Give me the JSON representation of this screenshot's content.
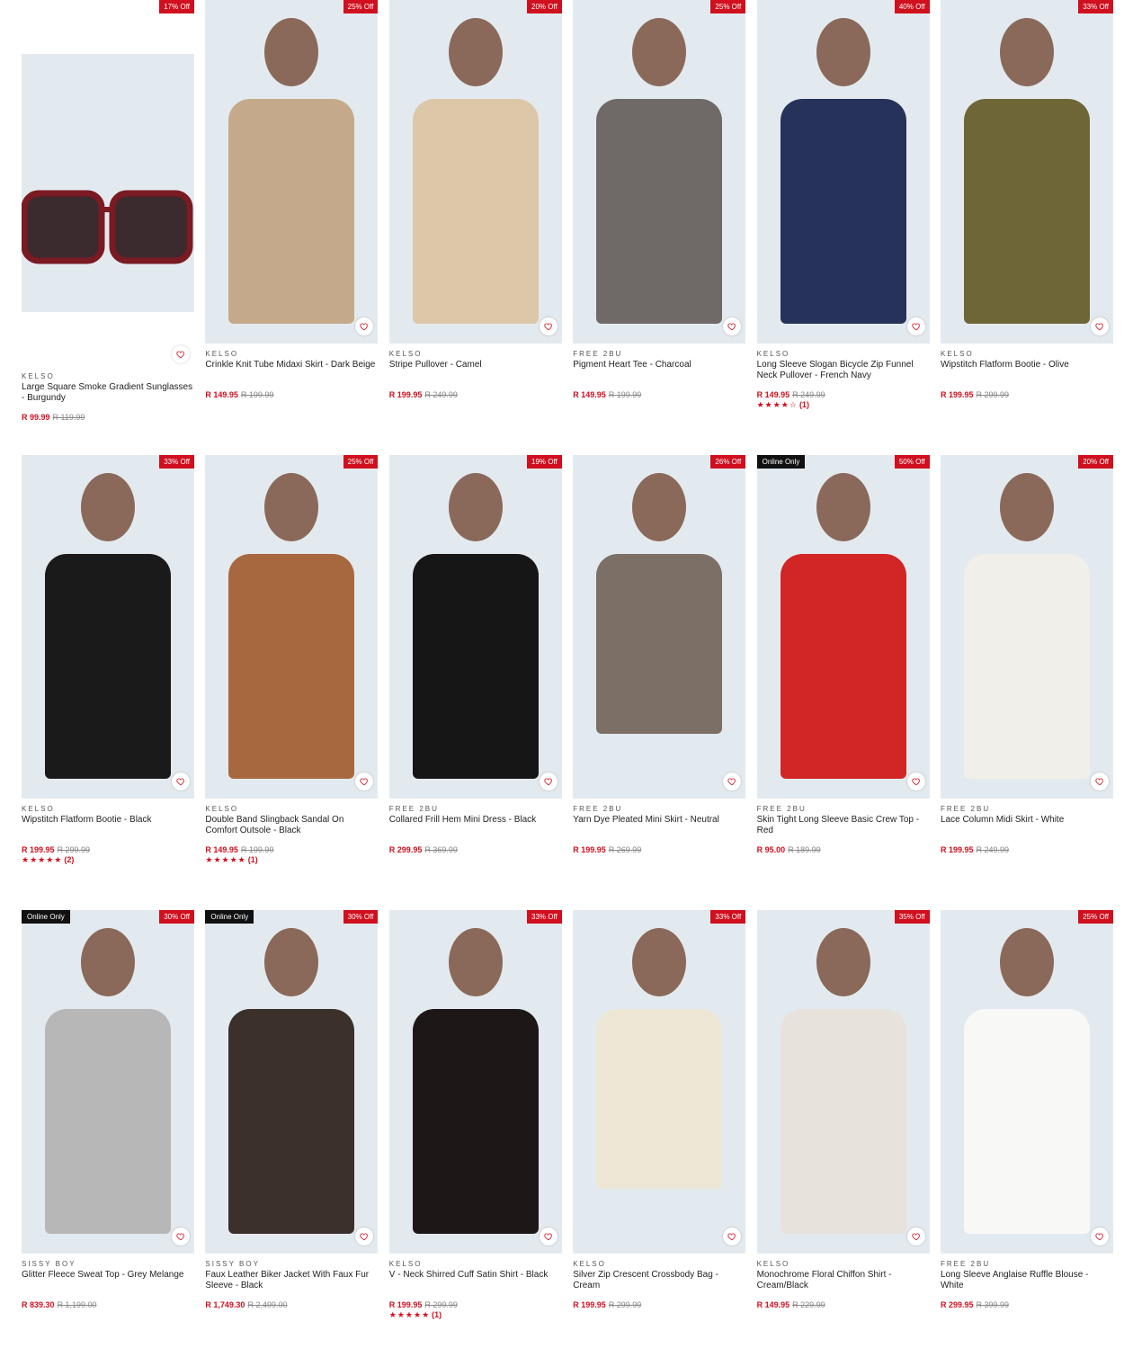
{
  "colors": {
    "accent": "#d0101e",
    "badge_text": "#ffffff",
    "online_badge_bg": "#111111"
  },
  "products": [
    {
      "brand": "KELSO",
      "name": "Large Square Smoke Gradient Sunglasses - Burgundy",
      "price": "R 99.99",
      "was": "R 119.99",
      "discount": "17% Off",
      "online_only": "",
      "rating": "",
      "rating_count": "",
      "image_icon": "sunglasses"
    },
    {
      "brand": "KELSO",
      "name": "Crinkle Knit Tube Midaxi Skirt - Dark Beige",
      "price": "R 149.95",
      "was": "R 199.99",
      "discount": "25% Off",
      "online_only": "",
      "rating": "",
      "rating_count": "",
      "image_icon": "skirt"
    },
    {
      "brand": "KELSO",
      "name": "Stripe Pullover - Camel",
      "price": "R 199.95",
      "was": "R 249.99",
      "discount": "20% Off",
      "online_only": "",
      "rating": "",
      "rating_count": "",
      "image_icon": "pullover"
    },
    {
      "brand": "FREE 2BU",
      "name": "Pigment Heart Tee - Charcoal",
      "price": "R 149.95",
      "was": "R 199.99",
      "discount": "25% Off",
      "online_only": "",
      "rating": "",
      "rating_count": "",
      "image_icon": "tee"
    },
    {
      "brand": "KELSO",
      "name": "Long Sleeve Slogan Bicycle Zip Funnel Neck Pullover - French Navy",
      "price": "R 149.95",
      "was": "R 249.99",
      "discount": "40% Off",
      "online_only": "",
      "rating": "★★★★☆",
      "rating_count": "(1)",
      "image_icon": "pullover"
    },
    {
      "brand": "KELSO",
      "name": "Wipstitch Flatform Bootie - Olive",
      "price": "R 199.95",
      "was": "R 299.99",
      "discount": "33% Off",
      "online_only": "",
      "rating": "",
      "rating_count": "",
      "image_icon": "boot"
    },
    {
      "brand": "KELSO",
      "name": "Wipstitch Flatform Bootie - Black",
      "price": "R 199.95",
      "was": "R 299.99",
      "discount": "33% Off",
      "online_only": "",
      "rating": "★★★★★",
      "rating_count": "(2)",
      "image_icon": "boot"
    },
    {
      "brand": "KELSO",
      "name": "Double Band Slingback Sandal On Comfort Outsole - Black",
      "price": "R 149.95",
      "was": "R 199.99",
      "discount": "25% Off",
      "online_only": "",
      "rating": "★★★★★",
      "rating_count": "(1)",
      "image_icon": "sandal"
    },
    {
      "brand": "FREE 2BU",
      "name": "Collared Frill Hem Mini Dress - Black",
      "price": "R 299.95",
      "was": "R 369.99",
      "discount": "19% Off",
      "online_only": "",
      "rating": "",
      "rating_count": "",
      "image_icon": "dress"
    },
    {
      "brand": "FREE 2BU",
      "name": "Yarn Dye Pleated Mini Skirt - Neutral",
      "price": "R 199.95",
      "was": "R 269.99",
      "discount": "26% Off",
      "online_only": "",
      "rating": "",
      "rating_count": "",
      "image_icon": "skirt"
    },
    {
      "brand": "FREE 2BU",
      "name": "Skin Tight Long Sleeve Basic Crew Top - Red",
      "price": "R 95.00",
      "was": "R 189.99",
      "discount": "50% Off",
      "online_only": "Online Only",
      "rating": "",
      "rating_count": "",
      "image_icon": "top"
    },
    {
      "brand": "FREE 2BU",
      "name": "Lace Column Midi Skirt - White",
      "price": "R 199.95",
      "was": "R 249.99",
      "discount": "20% Off",
      "online_only": "",
      "rating": "",
      "rating_count": "",
      "image_icon": "skirt"
    },
    {
      "brand": "SISSY BOY",
      "name": "Glitter Fleece Sweat Top - Grey Melange",
      "price": "R 839.30",
      "was": "R 1,199.00",
      "discount": "30% Off",
      "online_only": "Online Only",
      "rating": "",
      "rating_count": "",
      "image_icon": "sweat-top"
    },
    {
      "brand": "SISSY BOY",
      "name": "Faux Leather Biker Jacket With Faux Fur Sleeve - Black",
      "price": "R 1,749.30",
      "was": "R 2,499.00",
      "discount": "30% Off",
      "online_only": "Online Only",
      "rating": "",
      "rating_count": "",
      "image_icon": "jacket"
    },
    {
      "brand": "KELSO",
      "name": "V - Neck Shirred Cuff Satin Shirt - Black",
      "price": "R 199.95",
      "was": "R 299.99",
      "discount": "33% Off",
      "online_only": "",
      "rating": "★★★★★",
      "rating_count": "(1)",
      "image_icon": "shirt"
    },
    {
      "brand": "KELSO",
      "name": "Silver Zip Crescent Crossbody Bag - Cream",
      "price": "R 199.95",
      "was": "R 299.99",
      "discount": "33% Off",
      "online_only": "",
      "rating": "",
      "rating_count": "",
      "image_icon": "bag"
    },
    {
      "brand": "KELSO",
      "name": "Monochrome Floral Chiffon Shirt - Cream/Black",
      "price": "R 149.95",
      "was": "R 229.99",
      "discount": "35% Off",
      "online_only": "",
      "rating": "",
      "rating_count": "",
      "image_icon": "shirt"
    },
    {
      "brand": "FREE 2BU",
      "name": "Long Sleeve Anglaise Ruffle Blouse - White",
      "price": "R 299.95",
      "was": "R 399.99",
      "discount": "25% Off",
      "online_only": "",
      "rating": "",
      "rating_count": "",
      "image_icon": "blouse"
    }
  ]
}
